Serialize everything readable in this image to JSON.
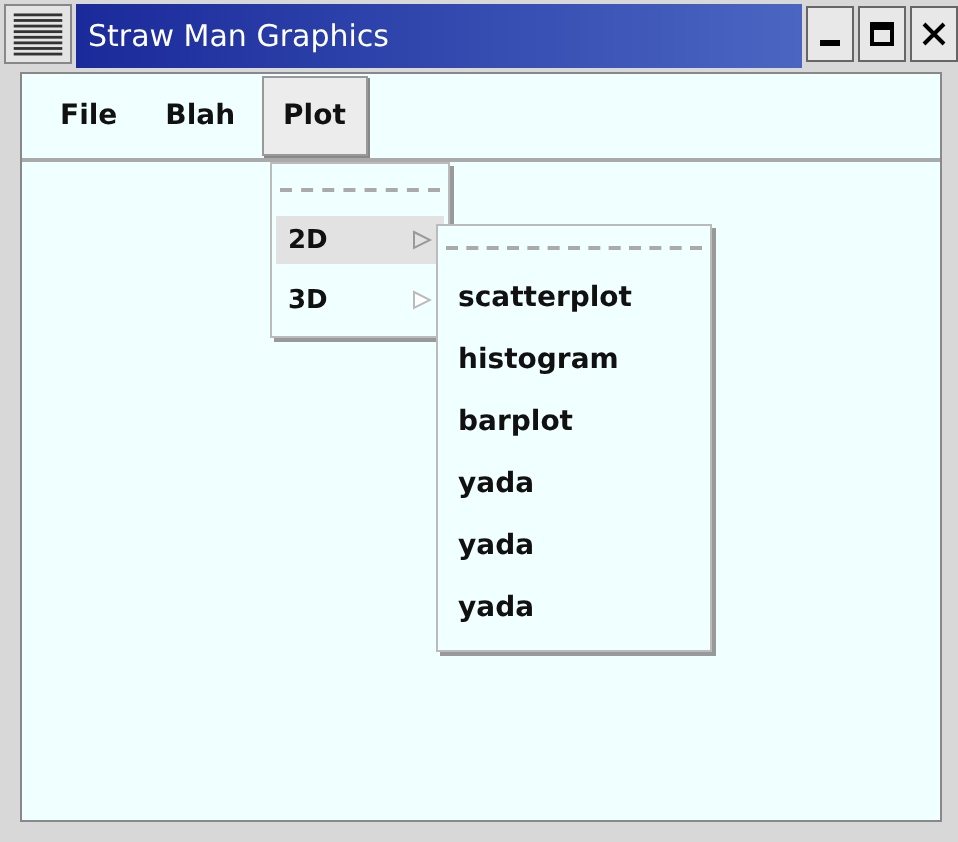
{
  "window": {
    "title": "Straw Man Graphics"
  },
  "menubar": [
    {
      "label": "File",
      "selected": false
    },
    {
      "label": "Blah",
      "selected": false
    },
    {
      "label": "Plot",
      "selected": true
    }
  ],
  "plot_menu": [
    {
      "label": "2D",
      "selected": true
    },
    {
      "label": "3D",
      "selected": false
    }
  ],
  "submenu_2d": [
    {
      "label": "scatterplot"
    },
    {
      "label": "histogram"
    },
    {
      "label": "barplot"
    },
    {
      "label": "yada"
    },
    {
      "label": "yada"
    },
    {
      "label": "yada"
    }
  ]
}
